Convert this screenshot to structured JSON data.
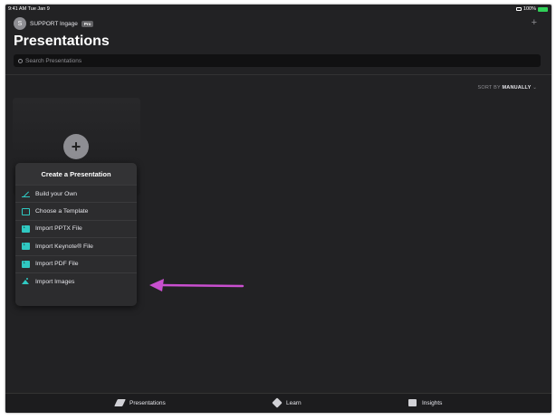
{
  "status_bar": {
    "time": "9:41 AM  Tue Jan 9",
    "battery": "100%"
  },
  "account": {
    "initial": "S",
    "name": "SUPPORT Ingage",
    "badge": "Pro"
  },
  "header": {
    "add_icon": "plus-icon",
    "title": "Presentations"
  },
  "search": {
    "placeholder": "Search Presentations"
  },
  "sort": {
    "label": "SORT BY",
    "value": "MANUALLY",
    "chevron": "⌄"
  },
  "create_menu": {
    "title": "Create a Presentation",
    "items": [
      {
        "label": "Build your Own",
        "icon": "pencil-icon"
      },
      {
        "label": "Choose a Template",
        "icon": "template-icon"
      },
      {
        "label": "Import PPTX File",
        "icon": "import-icon"
      },
      {
        "label": "Import Keynote® File",
        "icon": "import-icon"
      },
      {
        "label": "Import PDF File",
        "icon": "import-icon"
      },
      {
        "label": "Import Images",
        "icon": "image-icon"
      }
    ]
  },
  "tabbar": {
    "items": [
      {
        "label": "Presentations",
        "icon": "presentations-icon"
      },
      {
        "label": "Learn",
        "icon": "learn-icon"
      },
      {
        "label": "Insights",
        "icon": "insights-icon"
      }
    ]
  },
  "colors": {
    "accent": "#30c9c2",
    "annotation_arrow": "#c94fcf",
    "background": "#222224"
  }
}
